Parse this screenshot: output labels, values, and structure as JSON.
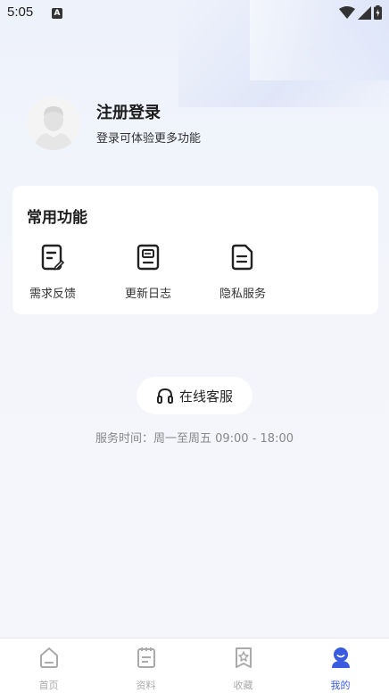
{
  "status_bar": {
    "time": "5:05",
    "notification_glyph": "A"
  },
  "profile": {
    "title": "注册登录",
    "subtitle": "登录可体验更多功能"
  },
  "common_functions": {
    "title": "常用功能",
    "items": [
      {
        "label": "需求反馈",
        "icon": "feedback-icon"
      },
      {
        "label": "更新日志",
        "icon": "update-log-icon"
      },
      {
        "label": "隐私服务",
        "icon": "privacy-icon"
      }
    ]
  },
  "service": {
    "button_label": "在线客服",
    "hours": "服务时间：周一至周五 09:00 - 18:00"
  },
  "bottom_nav": {
    "items": [
      {
        "label": "首页",
        "icon": "home-icon",
        "active": false
      },
      {
        "label": "资料",
        "icon": "documents-icon",
        "active": false
      },
      {
        "label": "收藏",
        "icon": "favorites-icon",
        "active": false
      },
      {
        "label": "我的",
        "icon": "profile-icon",
        "active": true
      }
    ]
  },
  "colors": {
    "accent": "#3a5be0",
    "background": "#f3f5fb",
    "inactive": "#aaaaaa"
  }
}
